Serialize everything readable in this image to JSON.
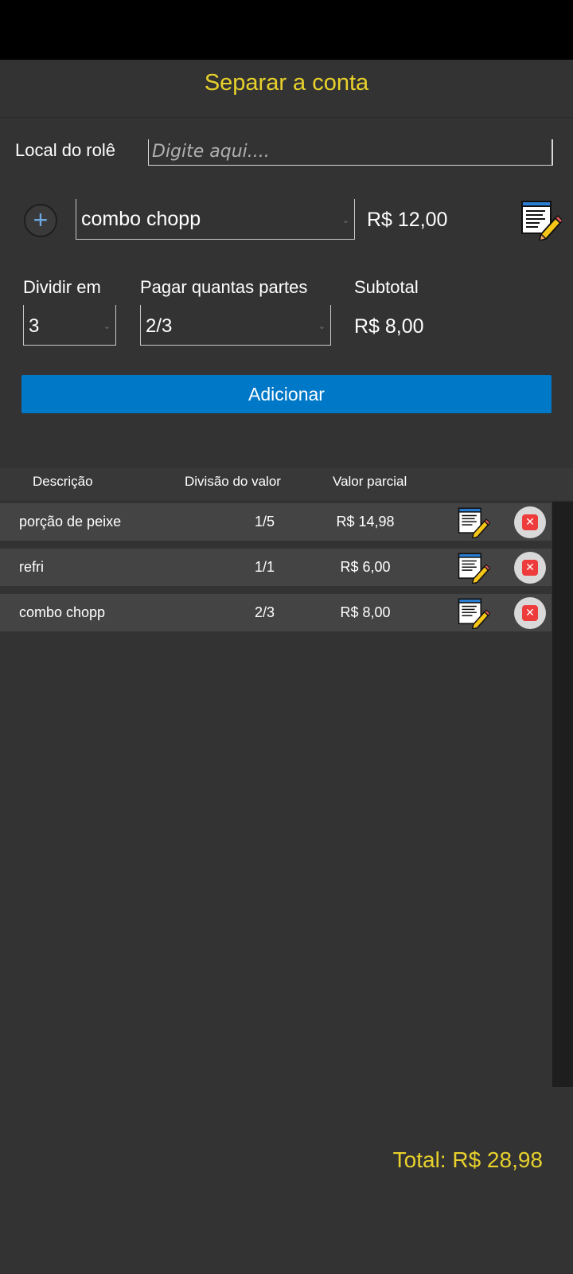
{
  "app": {
    "title": "Separar a conta"
  },
  "local": {
    "label": "Local do rolê",
    "placeholder": "Digite aqui...."
  },
  "item_entry": {
    "selected_item": "combo chopp",
    "price": "R$ 12,00"
  },
  "split": {
    "divide_label": "Dividir em",
    "divide_value": "3",
    "parts_label": "Pagar quantas partes",
    "parts_value": "2/3",
    "subtotal_label": "Subtotal",
    "subtotal_value": "R$ 8,00"
  },
  "add_button": "Adicionar",
  "table": {
    "headers": {
      "description": "Descrição",
      "division": "Divisão do valor",
      "partial": "Valor parcial"
    },
    "rows": [
      {
        "description": "porção de peixe",
        "division": "1/5",
        "partial": "R$ 14,98"
      },
      {
        "description": "refri",
        "division": "1/1",
        "partial": "R$ 6,00"
      },
      {
        "description": "combo chopp",
        "division": "2/3",
        "partial": "R$ 8,00"
      }
    ]
  },
  "total": "Total: R$ 28,98",
  "colors": {
    "accent_yellow": "#e8d12c",
    "button_blue": "#0078c8",
    "delete_red": "#ee3b3b"
  },
  "icons": {
    "add": "plus-circle-icon",
    "edit": "edit-note-icon",
    "delete": "close-icon"
  }
}
